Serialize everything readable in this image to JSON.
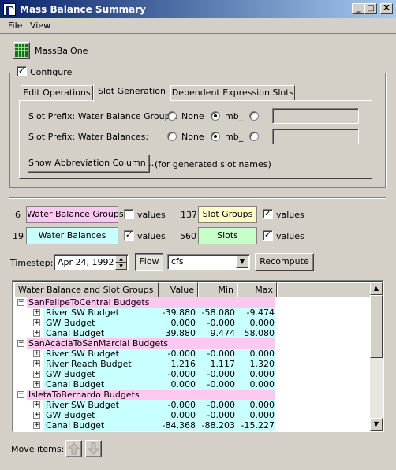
{
  "window": {
    "title": "Mass Balance Summary",
    "min": "_",
    "max": "□",
    "close": "X"
  },
  "menu": [
    "File",
    "View"
  ],
  "model": {
    "name": "MassBalOne",
    "icon": "grid-icon"
  },
  "configure": {
    "label": "Configure",
    "checked": true
  },
  "tabs": [
    "Edit Operations",
    "Slot Generation",
    "Dependent Expression Slots"
  ],
  "slot_generation": {
    "groups_prefix_label": "Slot Prefix: Water Balance Groups:",
    "balances_prefix_label": "Slot Prefix: Water Balances:",
    "opt_none": "None",
    "opt_mb": "mb_",
    "show_abbrev_button": "Show Abbreviation Column ...",
    "note": "(for generated slot names)"
  },
  "summary": {
    "wbg_count": "6",
    "wbg_label": "Water Balance Groups",
    "wb_count": "19",
    "wb_label": "Water Balances",
    "sg_count": "137",
    "sg_label": "Slot Groups",
    "slots_count": "560",
    "slots_label": "Slots",
    "values_label": "values",
    "colors": {
      "wbg": "#ffc8f0",
      "wb": "#c8ffff",
      "sg": "#ffffc8",
      "slots": "#c8ffc8"
    }
  },
  "timestep": {
    "label": "Timestep:",
    "date": "Apr 24, 1992",
    "flow_button": "Flow",
    "units": "cfs",
    "recompute_button": "Recompute"
  },
  "table": {
    "headers": [
      "Water Balance and Slot Groups",
      "Value",
      "Min",
      "Max"
    ],
    "groups": [
      {
        "name": "SanFelipeToCentral Budgets",
        "rows": [
          {
            "name": "River SW Budget",
            "value": "-39.880",
            "min": "-58.080",
            "max": "-9.474"
          },
          {
            "name": "GW Budget",
            "value": "0.000",
            "min": "-0.000",
            "max": "0.000"
          },
          {
            "name": "Canal Budget",
            "value": "39.880",
            "min": "9.474",
            "max": "58.080"
          }
        ]
      },
      {
        "name": "SanAcaciaToSanMarcial Budgets",
        "rows": [
          {
            "name": "River SW Budget",
            "value": "-0.000",
            "min": "-0.000",
            "max": "0.000"
          },
          {
            "name": "River Reach Budget",
            "value": "1.216",
            "min": "1.117",
            "max": "1.320"
          },
          {
            "name": "GW Budget",
            "value": "-0.000",
            "min": "-0.000",
            "max": "0.000"
          },
          {
            "name": "Canal Budget",
            "value": "0.000",
            "min": "-0.000",
            "max": "0.000"
          }
        ]
      },
      {
        "name": "IsletaToBernardo Budgets",
        "rows": [
          {
            "name": "River SW Budget",
            "value": "-0.000",
            "min": "-0.000",
            "max": "0.000"
          },
          {
            "name": "GW Budget",
            "value": "0.000",
            "min": "-0.000",
            "max": "0.000"
          },
          {
            "name": "Canal Budget",
            "value": "-84.368",
            "min": "-88.203",
            "max": "-15.227"
          }
        ]
      }
    ]
  },
  "move_items": {
    "label": "Move items:",
    "up": "up-arrow-icon",
    "down": "down-arrow-icon"
  }
}
